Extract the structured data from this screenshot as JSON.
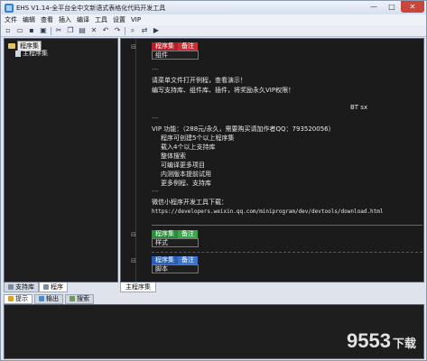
{
  "window": {
    "title": "EHS V1.14-全平台全中文新语式表格化代码开发工具",
    "controls": [
      "—",
      "□",
      "✕"
    ]
  },
  "menu": [
    "文件",
    "编辑",
    "查看",
    "插入",
    "编译",
    "工具",
    "设置",
    "VIP"
  ],
  "toolbar": {
    "icons": [
      "new-file-icon",
      "open-folder-icon",
      "save-icon",
      "save-all-icon",
      "cut-icon",
      "copy-icon",
      "paste-icon",
      "delete-icon",
      "undo-icon",
      "redo-icon",
      "find-icon",
      "replace-icon",
      "run-icon"
    ]
  },
  "tree": {
    "root": "程序集",
    "child": "主程序集"
  },
  "left_tabs": [
    "支持库",
    "程序"
  ],
  "editor": {
    "block1": {
      "head1": "程序集",
      "head2": "备注",
      "body": "组件"
    },
    "line_dash1": "---",
    "line1": "请菜单文件打开例程，查看演示！",
    "line2": "编写支持库、组件库、插件，将奖励永久VIP权限！",
    "line3": "BT sx",
    "line_dash2": "---",
    "vip_title": "VIP 功能：（288元/永久，需要购买请加作者QQ：793520056）",
    "vip_items": [
      "程序可创建5个以上程序集",
      "载入4个以上支持库",
      "整体搜索",
      "可编译更多项目",
      "内测版本提前试用",
      "更多例程、支持库"
    ],
    "line_dash3": "---",
    "mini_title": "微信小程序开发工具下载：",
    "mini_url": "https://developers.weixin.qq.com/miniprogram/dev/devtools/download.html",
    "block2": {
      "head1": "程序集",
      "head2": "备注",
      "body": "样式"
    },
    "block3": {
      "head1": "程序集",
      "head2": "备注",
      "body": "脚本"
    }
  },
  "editor_tabs": [
    "主程序集"
  ],
  "bottom_tabs": [
    "提示",
    "输出",
    "搜索"
  ],
  "watermark": {
    "main": "9553",
    "sub": "下载"
  },
  "colors": {
    "editor_bg": "#1b1b1b",
    "header_red": "#b3202a",
    "header_green": "#2a8c3a",
    "header_blue": "#2a5fb3"
  }
}
